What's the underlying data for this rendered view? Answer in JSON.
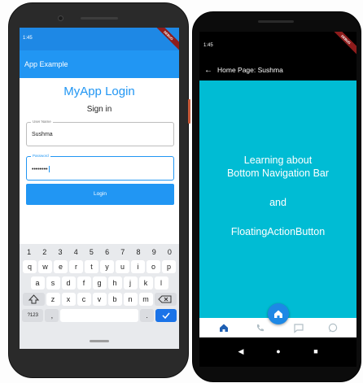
{
  "phone1": {
    "status_time": "1:45",
    "debug_banner": "DEBUG",
    "app_bar_title": "App Example",
    "login_title": "MyApp Login",
    "subtitle": "Sign in",
    "username_label": "User Name",
    "username_value": "Sushma",
    "password_label": "Password",
    "password_value": "••••••••",
    "login_button": "Login",
    "keyboard": {
      "row_numbers": [
        "1",
        "2",
        "3",
        "4",
        "5",
        "6",
        "7",
        "8",
        "9",
        "0"
      ],
      "row1": [
        "q",
        "w",
        "e",
        "r",
        "t",
        "y",
        "u",
        "i",
        "o",
        "p"
      ],
      "row2": [
        "a",
        "s",
        "d",
        "f",
        "g",
        "h",
        "j",
        "k",
        "l"
      ],
      "row3": [
        "z",
        "x",
        "c",
        "v",
        "b",
        "n",
        "m"
      ],
      "symbols_key": "?123",
      "comma_key": ",",
      "period_key": "."
    }
  },
  "phone2": {
    "status_time": "1:45",
    "debug_banner": "DEBUG",
    "app_bar_title": "Home Page: Sushma",
    "line1": "Learning about",
    "line2": "Bottom Navigation Bar",
    "line3": "and",
    "line4": "FloatingActionButton",
    "bottom_nav_icons": [
      "home-icon",
      "phone-icon",
      "chat-icon",
      "whatsapp-icon"
    ],
    "fab_icon": "home-icon"
  },
  "colors": {
    "primary": "#2196f3",
    "primary_dark": "#1e88e5",
    "cyan_background": "#00bcd4",
    "enter_key": "#1a73e8"
  }
}
